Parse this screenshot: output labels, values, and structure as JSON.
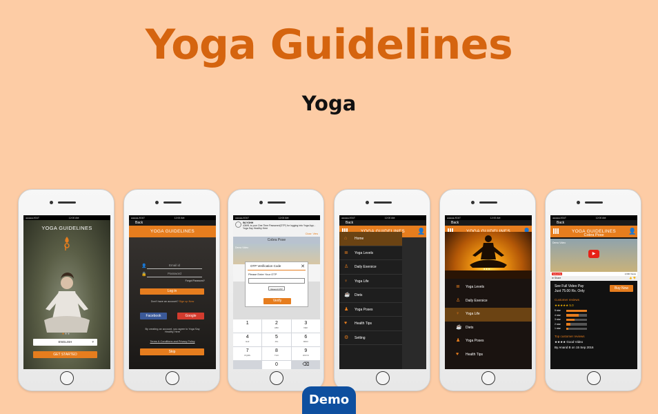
{
  "header": {
    "title": "Yoga Guidelines",
    "subtitle": "Yoga"
  },
  "status": {
    "carrier": "●●●●● AT&T",
    "time": "12:00 AM"
  },
  "app_title": "YOGA GUIDELINES",
  "back_label": "Back",
  "screen1": {
    "language": "ENGLISH",
    "get_started": "GET STARTED"
  },
  "screen2": {
    "email_placeholder": "Email id",
    "password_placeholder": "Password",
    "forgot": "Forgot Password?",
    "login": "Log in",
    "no_account": "Don't have an account?",
    "signup": "Sign up Now",
    "facebook": "Facebook",
    "google": "Google",
    "agree": "By creating an account, you agree to Yoga Say Healthy Here",
    "terms": "Terms & Conditions and Privacy Policy",
    "skip": "Skip"
  },
  "screen3": {
    "notif_sender": "IM-YGHH",
    "notif_text": "43691 is your One Time Password(OTP) for logging into Yoga App - Yoga Say Healthy Here",
    "notif_close": "Close",
    "notif_view": "View",
    "pose_title": "Cobra Pose",
    "video_label": "Demo Video",
    "otp_title": "OTP Verification Code",
    "otp_prompt": "Please Enter Your OTP",
    "resend": "Resend OTP",
    "verify": "Verify",
    "keys": [
      {
        "num": "1",
        "letters": ""
      },
      {
        "num": "2",
        "letters": "ABC"
      },
      {
        "num": "3",
        "letters": "DEF"
      },
      {
        "num": "4",
        "letters": "GHI"
      },
      {
        "num": "5",
        "letters": "JKL"
      },
      {
        "num": "6",
        "letters": "MNO"
      },
      {
        "num": "7",
        "letters": "PQRS"
      },
      {
        "num": "8",
        "letters": "TUV"
      },
      {
        "num": "9",
        "letters": "WXYZ"
      },
      {
        "num": "",
        "letters": ""
      },
      {
        "num": "0",
        "letters": ""
      },
      {
        "num": "⌫",
        "letters": ""
      }
    ]
  },
  "screen4": {
    "menu": [
      {
        "label": "Home",
        "icon": "home-icon"
      },
      {
        "label": "Yoga Levels",
        "icon": "levels-icon"
      },
      {
        "label": "Daily Exersice",
        "icon": "exercise-icon"
      },
      {
        "label": "Yoga Life",
        "icon": "yoga-life-icon"
      },
      {
        "label": "Diets",
        "icon": "diet-icon"
      },
      {
        "label": "Yoga Poses",
        "icon": "pose-icon"
      },
      {
        "label": "Health Tips",
        "icon": "heart-icon"
      },
      {
        "label": "Setting",
        "icon": "gear-icon"
      }
    ]
  },
  "screen5": {
    "menu": [
      {
        "label": "Yoga Levels"
      },
      {
        "label": "Daily Exersice"
      },
      {
        "label": "Yoga Life"
      },
      {
        "label": "Diets"
      },
      {
        "label": "Yoga Poses"
      },
      {
        "label": "Health Tips"
      }
    ]
  },
  "screen6": {
    "pose_title": "Cobra Pose",
    "video_label": "Demo Video",
    "subscribe": "Subscribe",
    "views": "2,000 Views",
    "share": "Share",
    "full_video": "See Full Video Pay",
    "price": "Just 75.00 Rs. Only",
    "buy": "Buy Now",
    "customer_reviews": "Customer reviews",
    "rating": "★★★★★ 5.0",
    "star_rows": [
      {
        "label": "5 star",
        "fraction": 1.0
      },
      {
        "label": "4 star",
        "fraction": 0.6
      },
      {
        "label": "3 star",
        "fraction": 0.4
      },
      {
        "label": "2 star",
        "fraction": 0.2
      },
      {
        "label": "1 star",
        "fraction": 0.1
      }
    ],
    "top_reviews": "Top customer reviews",
    "review": "★★★★ Good Video",
    "review_by": "By Anand B on 15 Sep 2016"
  },
  "demo_label": "Demo",
  "colors": {
    "background": "#fdcca5",
    "accent": "#e67d1e",
    "title": "#d5640f",
    "demo": "#0e4f9f"
  }
}
